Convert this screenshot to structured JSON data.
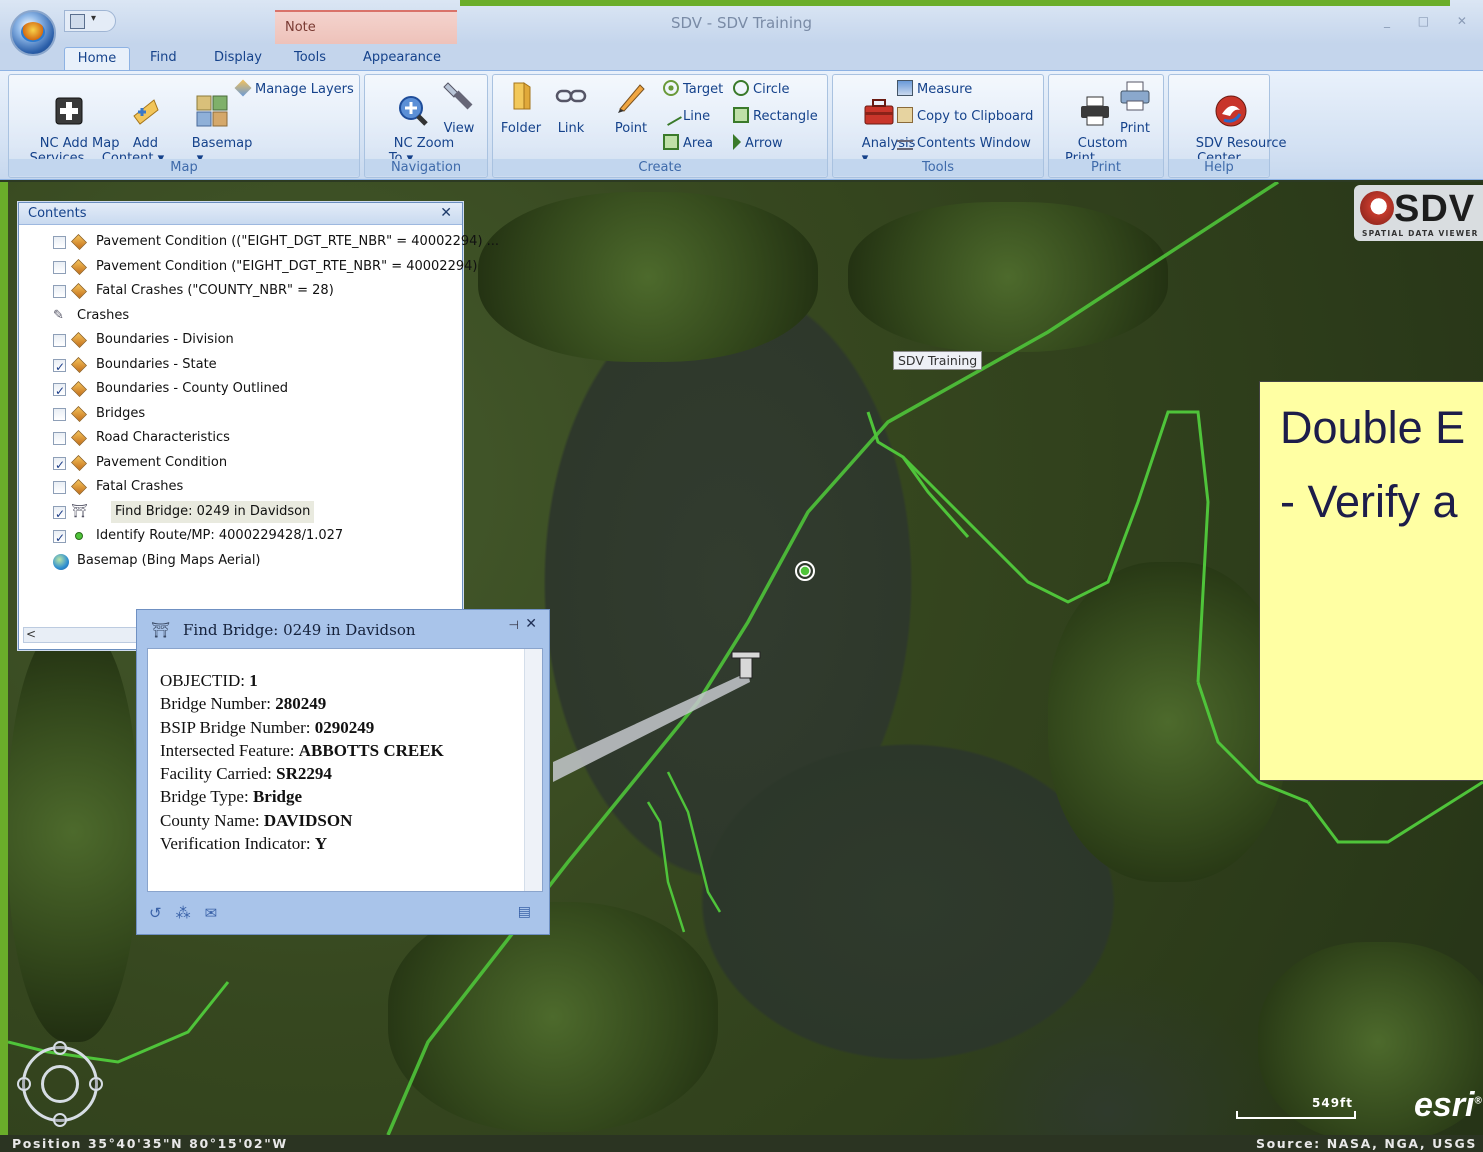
{
  "window": {
    "title": "SDV - SDV Training",
    "controls": "_ □ ✕"
  },
  "context_tab": {
    "label": "Note"
  },
  "tabs": [
    {
      "label": "Home",
      "active": true
    },
    {
      "label": "Find"
    },
    {
      "label": "Display"
    },
    {
      "label": "Tools"
    },
    {
      "label": "Appearance"
    }
  ],
  "ribbon": {
    "map": {
      "label": "Map",
      "nc_add_map_services": "NC Add Map\nServices",
      "add_content": "Add\nContent ▾",
      "basemap": "Basemap\n▾",
      "manage_layers": "Manage Layers"
    },
    "navigation": {
      "label": "Navigation",
      "nc_zoom_to": "NC Zoom\nTo ▾",
      "view": "View"
    },
    "create": {
      "label": "Create",
      "folder": "Folder",
      "link": "Link",
      "point": "Point",
      "target": "Target",
      "line": "Line",
      "area": "Area",
      "circle": "Circle",
      "rectangle": "Rectangle",
      "arrow": "Arrow"
    },
    "tools": {
      "label": "Tools",
      "analysis": "Analysis\n▾",
      "measure": "Measure",
      "copy_to_clipboard": "Copy to Clipboard",
      "contents_window": "Contents Window"
    },
    "print": {
      "label": "Print",
      "custom_print": "Custom\nPrint",
      "print": "Print"
    },
    "help": {
      "label": "Help",
      "sdv_resource_center": "SDV Resource\nCenter"
    }
  },
  "contents": {
    "title": "Contents",
    "layers": [
      {
        "label": "Pavement Condition ((\"EIGHT_DGT_RTE_NBR\" = 40002294) ...",
        "checked": false,
        "icon": "layer-diamond-icon"
      },
      {
        "label": "Pavement Condition (\"EIGHT_DGT_RTE_NBR\" = 40002294)",
        "checked": false,
        "icon": "layer-diamond-icon"
      },
      {
        "label": "Fatal Crashes (\"COUNTY_NBR\" = 28)",
        "checked": false,
        "icon": "layer-diamond-icon"
      },
      {
        "label": "Crashes",
        "checked": null,
        "icon": "crashes-pin-icon"
      },
      {
        "label": "Boundaries - Division",
        "checked": false,
        "icon": "layer-diamond-icon"
      },
      {
        "label": "Boundaries - State",
        "checked": true,
        "icon": "layer-diamond-icon"
      },
      {
        "label": "Boundaries - County Outlined",
        "checked": true,
        "icon": "layer-diamond-icon"
      },
      {
        "label": "Bridges",
        "checked": false,
        "icon": "layer-diamond-icon"
      },
      {
        "label": "Road Characteristics",
        "checked": false,
        "icon": "layer-diamond-icon"
      },
      {
        "label": "Pavement Condition",
        "checked": true,
        "icon": "layer-diamond-icon"
      },
      {
        "label": "Fatal Crashes",
        "checked": false,
        "icon": "layer-diamond-icon"
      },
      {
        "label": "Find Bridge: 0249 in Davidson",
        "checked": true,
        "icon": "bridge-icon",
        "selected": true
      },
      {
        "label": "Identify Route/MP: 4000229428/1.027",
        "checked": true,
        "icon": "identify-dot-icon"
      },
      {
        "label": "Basemap (Bing Maps Aerial)",
        "checked": null,
        "icon": "globe-icon"
      }
    ]
  },
  "popup": {
    "title": "Find Bridge: 0249 in Davidson",
    "fields": [
      {
        "label": "OBJECTID:",
        "value": "1"
      },
      {
        "label": "Bridge Number:",
        "value": "280249"
      },
      {
        "label": "BSIP Bridge Number:",
        "value": "0290249"
      },
      {
        "label": "Intersected Feature:",
        "value": "ABBOTTS CREEK"
      },
      {
        "label": "Facility Carried:",
        "value": "SR2294"
      },
      {
        "label": "Bridge Type:",
        "value": "Bridge"
      },
      {
        "label": "County Name:",
        "value": "DAVIDSON"
      },
      {
        "label": "Verification Indicator:",
        "value": "Y"
      }
    ]
  },
  "map": {
    "label_tip": "SDV Training",
    "logo_word": "SDV",
    "logo_tagline": "SPATIAL DATA VIEWER",
    "scale": "549ft",
    "esri": "esri",
    "status_position": "Position 35°40'35\"N 80°15'02\"W",
    "status_source": "Source: NASA, NGA, USGS"
  },
  "callout": {
    "line1": "Double E",
    "line2": "- Verify a"
  },
  "colors": {
    "route_green": "#4fc43a",
    "ribbon_text": "#15428b",
    "callout_bg": "#ffffa3"
  }
}
